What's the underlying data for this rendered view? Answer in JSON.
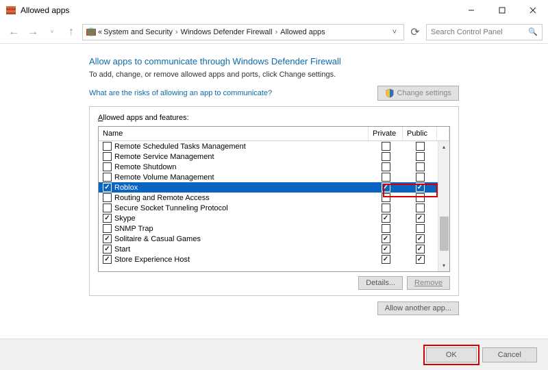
{
  "window": {
    "title": "Allowed apps"
  },
  "winbtns": {
    "min": "",
    "max": "",
    "close": ""
  },
  "breadcrumb": {
    "prefix": "«",
    "items": [
      "System and Security",
      "Windows Defender Firewall",
      "Allowed apps"
    ]
  },
  "search": {
    "placeholder": "Search Control Panel"
  },
  "heading": "Allow apps to communicate through Windows Defender Firewall",
  "subtext": "To add, change, or remove allowed apps and ports, click Change settings.",
  "risk_link": "What are the risks of allowing an app to communicate?",
  "change_settings": "Change settings",
  "panel_label_pre": "A",
  "panel_label_rest": "llowed apps and features:",
  "columns": {
    "name": "Name",
    "private": "Private",
    "public": "Public"
  },
  "rows": [
    {
      "label": "Remote Scheduled Tasks Management",
      "on": false,
      "priv": false,
      "pub": false,
      "selected": false
    },
    {
      "label": "Remote Service Management",
      "on": false,
      "priv": false,
      "pub": false,
      "selected": false
    },
    {
      "label": "Remote Shutdown",
      "on": false,
      "priv": false,
      "pub": false,
      "selected": false
    },
    {
      "label": "Remote Volume Management",
      "on": false,
      "priv": false,
      "pub": false,
      "selected": false
    },
    {
      "label": "Roblox",
      "on": true,
      "priv": true,
      "pub": true,
      "selected": true
    },
    {
      "label": "Routing and Remote Access",
      "on": false,
      "priv": false,
      "pub": false,
      "selected": false
    },
    {
      "label": "Secure Socket Tunneling Protocol",
      "on": false,
      "priv": false,
      "pub": false,
      "selected": false
    },
    {
      "label": "Skype",
      "on": true,
      "priv": true,
      "pub": true,
      "selected": false
    },
    {
      "label": "SNMP Trap",
      "on": false,
      "priv": false,
      "pub": false,
      "selected": false
    },
    {
      "label": "Solitaire & Casual Games",
      "on": true,
      "priv": true,
      "pub": true,
      "selected": false
    },
    {
      "label": "Start",
      "on": true,
      "priv": true,
      "pub": true,
      "selected": false
    },
    {
      "label": "Store Experience Host",
      "on": true,
      "priv": true,
      "pub": true,
      "selected": false
    }
  ],
  "details_btn": "Details...",
  "remove_btn": "Remove",
  "allow_another": "Allow another app...",
  "ok": "OK",
  "cancel": "Cancel"
}
